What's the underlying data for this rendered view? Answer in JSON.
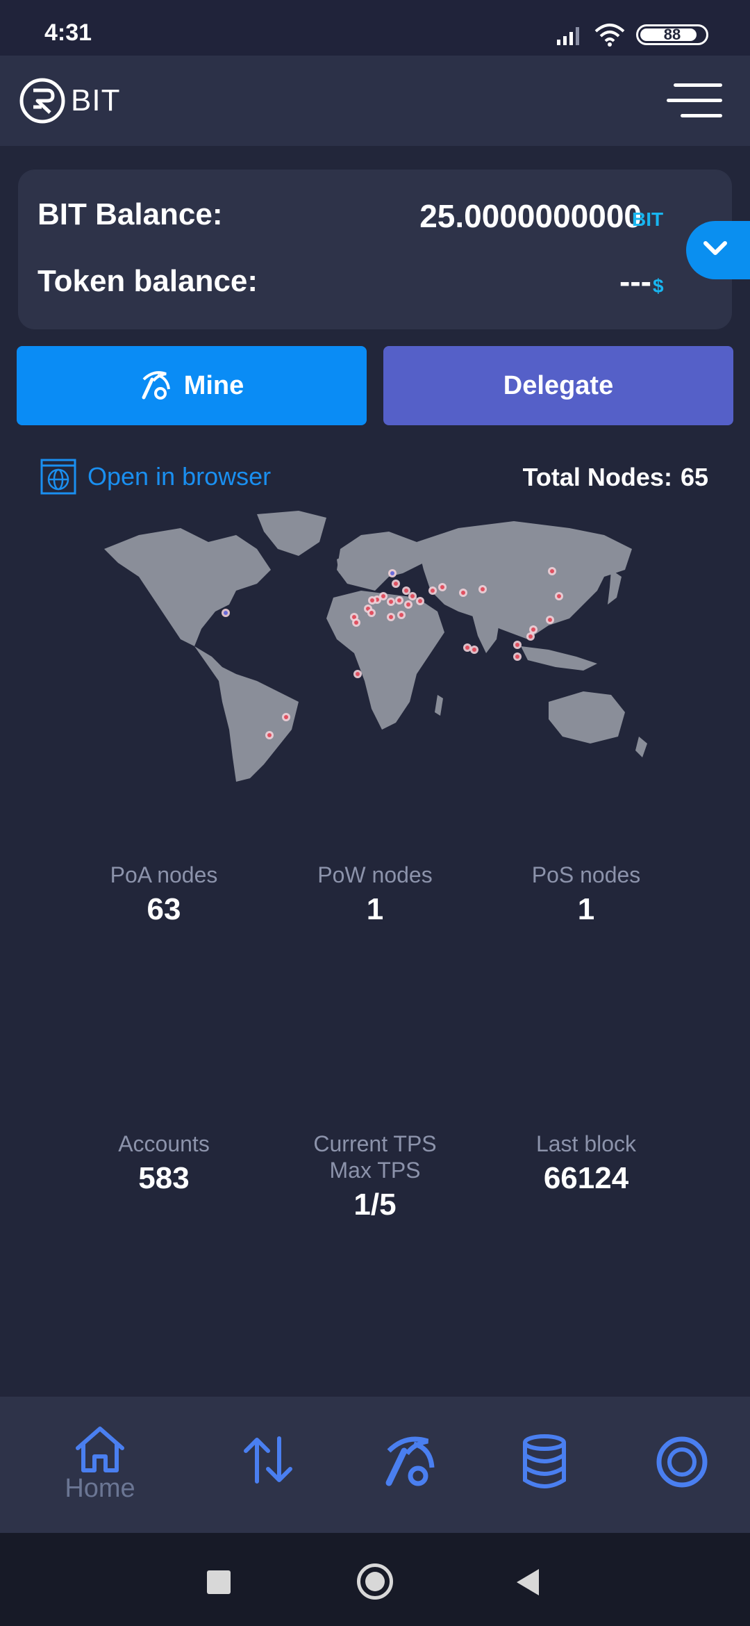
{
  "status_bar": {
    "time": "4:31",
    "battery": "88",
    "battery_level": 0.88
  },
  "header": {
    "logo_text": "BIT"
  },
  "balance": {
    "bit_label": "BIT Balance:",
    "bit_value": "25.0000000000",
    "bit_unit": "BIT",
    "token_label": "Token balance:",
    "token_value": "---",
    "token_unit": "$"
  },
  "actions": {
    "mine_label": "Mine",
    "delegate_label": "Delegate"
  },
  "browser": {
    "open_label": "Open in browser"
  },
  "nodes": {
    "total_label": "Total Nodes:",
    "total_value": "65"
  },
  "stats": {
    "poa_label": "PoA nodes",
    "poa_value": "63",
    "pow_label": "PoW nodes",
    "pow_value": "1",
    "pos_label": "PoS nodes",
    "pos_value": "1",
    "accounts_label": "Accounts",
    "accounts_value": "583",
    "tps_label_1": "Current TPS",
    "tps_label_2": "Max TPS",
    "tps_value": "1/5",
    "last_block_label": "Last block",
    "last_block_value": "66124"
  },
  "nav": {
    "home_label": "Home",
    "items": [
      "home-icon",
      "transfer-icon",
      "mine-icon",
      "database-icon",
      "lifebuoy-icon"
    ]
  },
  "colors": {
    "background": "#22263a",
    "card": "#2e3349",
    "accent": "#0a8cf5",
    "delegate": "#5560c8",
    "unit": "#18b6f0",
    "nav_icon": "#4a7ff0"
  }
}
